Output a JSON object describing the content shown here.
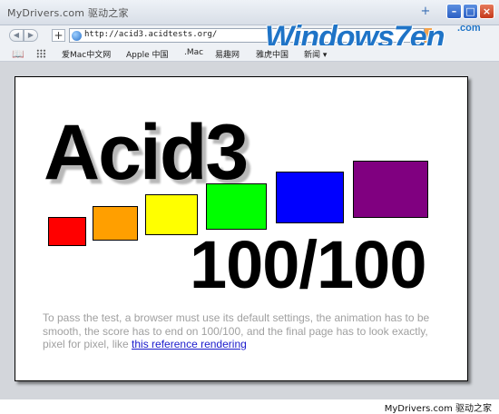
{
  "window": {
    "title": "MyDrivers.com 驱动之家",
    "new_tab_icon": "plus-icon",
    "min_icon": "minimize-icon",
    "max_icon": "maximize-icon",
    "close_icon": "close-icon"
  },
  "navbar": {
    "url": "http://acid3.acidtests.org/",
    "logo": "Windows7en",
    "logo_suffix": ".com"
  },
  "bookmarks": {
    "items": [
      "爱Mac中文网",
      "Apple 中国",
      ".Mac",
      "易趣网",
      "雅虎中国",
      "新闻 ▾"
    ]
  },
  "page": {
    "title": "Acid3",
    "score": "100/100",
    "description": "To pass the test, a browser must use its default settings, the animation has to be smooth, the score has to end on 100/100, and the final page has to look exactly, pixel for pixel, like ",
    "link_text": "this reference rendering",
    "box_colors": [
      "#ff0000",
      "#ff9f00",
      "#ffff00",
      "#00ff00",
      "#0000ff",
      "#800080"
    ]
  },
  "status": {
    "text": "MyDrivers.com 驱动之家"
  }
}
